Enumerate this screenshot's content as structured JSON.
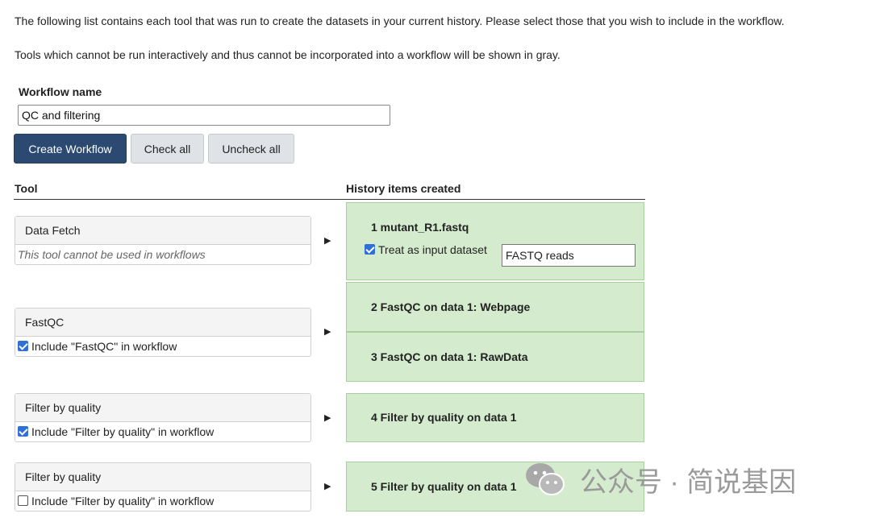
{
  "intro": {
    "line1": "The following list contains each tool that was run to create the datasets in your current history. Please select those that you wish to include in the workflow.",
    "line2": "Tools which cannot be run interactively and thus cannot be incorporated into a workflow will be shown in gray."
  },
  "workflow": {
    "name_label": "Workflow name",
    "name_value": "QC and filtering"
  },
  "buttons": {
    "create": "Create Workflow",
    "check_all": "Check all",
    "uncheck_all": "Uncheck all"
  },
  "columns": {
    "tool": "Tool",
    "history": "History items created"
  },
  "tools": [
    {
      "name": "Data Fetch",
      "note": "This tool cannot be used in workflows",
      "checked": false
    },
    {
      "name": "FastQC",
      "include": "Include \"FastQC\" in workflow",
      "checked": true
    },
    {
      "name": "Filter by quality",
      "include": "Include \"Filter by quality\" in workflow",
      "checked": true
    },
    {
      "name": "Filter by quality",
      "include": "Include \"Filter by quality\" in workflow",
      "checked": false
    }
  ],
  "arrow_glyph": "▶",
  "history": {
    "item1": {
      "title": "1 mutant_R1.fastq",
      "treat_label": "Treat as input dataset",
      "treat_checked": true,
      "input_value": "FASTQ reads"
    },
    "item2": {
      "title": "2 FastQC on data 1: Webpage"
    },
    "item3": {
      "title": "3 FastQC on data 1: RawData"
    },
    "item4": {
      "title": "4 Filter by quality on data 1"
    },
    "item5": {
      "title": "5 Filter by quality on data 1"
    }
  },
  "watermark": {
    "text": "公众号 · 简说基因",
    "icon": "wechat-icon"
  }
}
